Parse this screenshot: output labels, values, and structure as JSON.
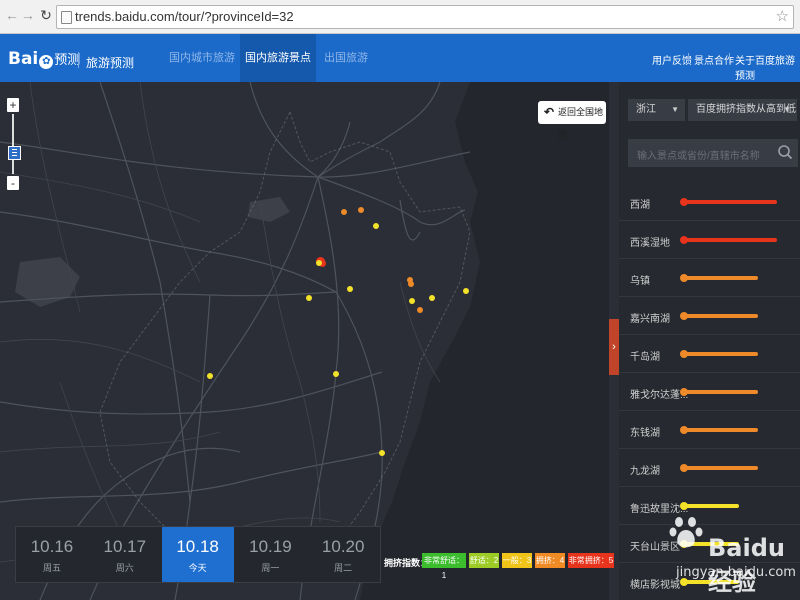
{
  "browser": {
    "url": "trends.baidu.com/tour/?provinceId=32"
  },
  "header": {
    "logo_main": "Bai",
    "logo_paw": "du",
    "logo_sub": "预测",
    "product": "旅游预测",
    "tabs": [
      {
        "label": "国内城市旅游",
        "active": false
      },
      {
        "label": "国内旅游景点",
        "active": true
      },
      {
        "label": "出国旅游",
        "active": false
      }
    ],
    "links": [
      "用户反馈",
      "景点合作",
      "关于百度旅游预测"
    ]
  },
  "map": {
    "zoom_in": "+",
    "zoom_out": "-",
    "back_label": "返回全国地图",
    "back_icon": "undo-arrow-icon",
    "dot_colors": {
      "red": "#e8341c",
      "orange": "#ee8a2a",
      "yellow": "#f3e12a"
    }
  },
  "panel": {
    "province": "浙江",
    "sort": "百度拥挤指数从高到低",
    "search_placeholder": "输入景点或省份/直辖市名称",
    "items": [
      {
        "name": "西湖",
        "level": 5,
        "color": "#e8341c"
      },
      {
        "name": "西溪湿地",
        "level": 5,
        "color": "#e8341c"
      },
      {
        "name": "乌镇",
        "level": 4,
        "color": "#ee8a2a"
      },
      {
        "name": "嘉兴南湖",
        "level": 4,
        "color": "#ee8a2a"
      },
      {
        "name": "千岛湖",
        "level": 4,
        "color": "#ee8a2a"
      },
      {
        "name": "雅戈尔达蓬...",
        "level": 4,
        "color": "#ee8a2a"
      },
      {
        "name": "东钱湖",
        "level": 4,
        "color": "#ee8a2a"
      },
      {
        "name": "九龙湖",
        "level": 4,
        "color": "#ee8a2a"
      },
      {
        "name": "鲁迅故里沈...",
        "level": 3,
        "color": "#f3e12a"
      },
      {
        "name": "天台山景区",
        "level": 3,
        "color": "#f3e12a"
      },
      {
        "name": "横店影视城",
        "level": 3,
        "color": "#f3e12a"
      }
    ]
  },
  "dates": [
    {
      "date": "10.16",
      "weekday": "周五",
      "active": false
    },
    {
      "date": "10.17",
      "weekday": "周六",
      "active": false
    },
    {
      "date": "10.18",
      "weekday": "今天",
      "active": true
    },
    {
      "date": "10.19",
      "weekday": "周一",
      "active": false
    },
    {
      "date": "10.20",
      "weekday": "周二",
      "active": false
    }
  ],
  "legend": {
    "label": "拥挤指数：",
    "items": [
      {
        "text": "非常舒适：1",
        "color": "#3cbd2e"
      },
      {
        "text": "舒适：2",
        "color": "#9ccc25"
      },
      {
        "text": "一般：3",
        "color": "#f0c419"
      },
      {
        "text": "拥挤：4",
        "color": "#f08a24"
      },
      {
        "text": "非常拥挤：5",
        "color": "#e8341c"
      }
    ]
  },
  "watermark": {
    "text_main": "Baidu 经验",
    "text_url": "jingyan.baidu.com"
  }
}
